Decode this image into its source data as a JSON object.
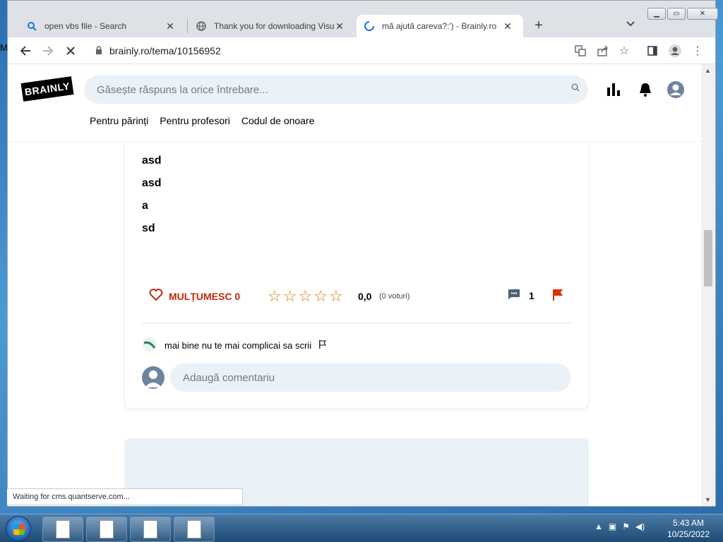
{
  "desktop": {
    "edge_text": "M"
  },
  "browser": {
    "tabs": [
      {
        "title": "open vbs file - Search",
        "icon": "search-icon"
      },
      {
        "title": "Thank you for downloading Visual",
        "icon": "globe-icon"
      },
      {
        "title": "mă ajută careva?:') - Brainly.ro",
        "icon": "loading-spinner-icon"
      }
    ],
    "new_tab_label": "+",
    "url": "brainly.ro/tema/10156952",
    "status_text": "Waiting for cms.quantserve.com..."
  },
  "site": {
    "logo_text": "BRAINLY",
    "search_placeholder": "Găsește răspuns la orice întrebare...",
    "nav": [
      "Pentru părinți",
      "Pentru profesori",
      "Codul de onoare"
    ]
  },
  "answer": {
    "lines": [
      "asd",
      "asd",
      "a",
      "sd"
    ],
    "thanks_label": "MULȚUMESC 0",
    "rating_value": "0,0",
    "rating_stars": 0,
    "votes_label": "(0 voturi)",
    "comment_count": "1",
    "comments": [
      {
        "text": "mai bine nu te mai complicai sa scrii"
      }
    ],
    "add_comment_placeholder": "Adaugă comentariu"
  },
  "taskbar": {
    "time": "5:43 AM",
    "date": "10/25/2022"
  },
  "colors": {
    "accent_red": "#c3280c",
    "star_gold": "#c98600",
    "search_bg": "#ebf2f7"
  }
}
